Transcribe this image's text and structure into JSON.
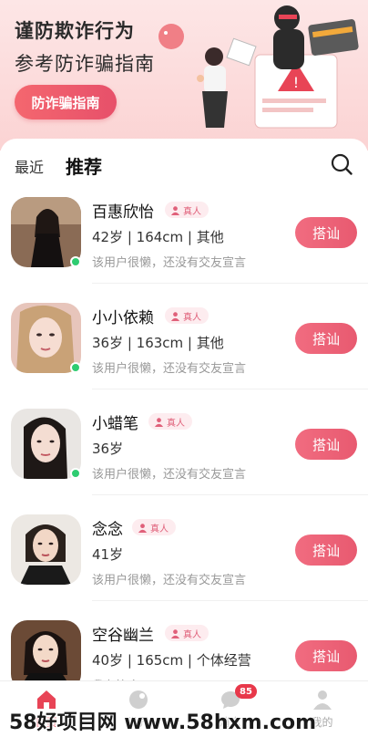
{
  "banner": {
    "title": "谨防欺诈行为",
    "subtitle": "参考防诈骗指南",
    "button_label": "防诈骗指南"
  },
  "tabs": {
    "recent": "最近",
    "recommend": "推荐"
  },
  "users": [
    {
      "name": "百惠欣怡",
      "badge": "真人",
      "info": "42岁 | 164cm | 其他",
      "slogan": "该用户很懒，还没有交友宣言",
      "button": "搭讪",
      "online": true
    },
    {
      "name": "小小依赖",
      "badge": "真人",
      "info": "36岁 | 163cm | 其他",
      "slogan": "该用户很懒，还没有交友宣言",
      "button": "搭讪",
      "online": true
    },
    {
      "name": "小蜡笔",
      "badge": "真人",
      "info": "36岁",
      "slogan": "该用户很懒，还没有交友宣言",
      "button": "搭讪",
      "online": true
    },
    {
      "name": "念念",
      "badge": "真人",
      "info": "41岁",
      "slogan": "该用户很懒，还没有交友宣言",
      "button": "搭讪",
      "online": false
    },
    {
      "name": "空谷幽兰",
      "badge": "真人",
      "info": "40岁 | 165cm | 个体经营",
      "slogan": "我有符合",
      "button": "搭讪",
      "online": false
    }
  ],
  "nav": {
    "home": "首页",
    "discover": "世界",
    "messages": "消息",
    "messages_badge": "85",
    "me": "我的"
  },
  "watermark": "58好项目网 www.58hxm.com",
  "colors": {
    "accent": "#e85a70",
    "online": "#2ecc71",
    "banner_bg": "#fbd3d3"
  }
}
